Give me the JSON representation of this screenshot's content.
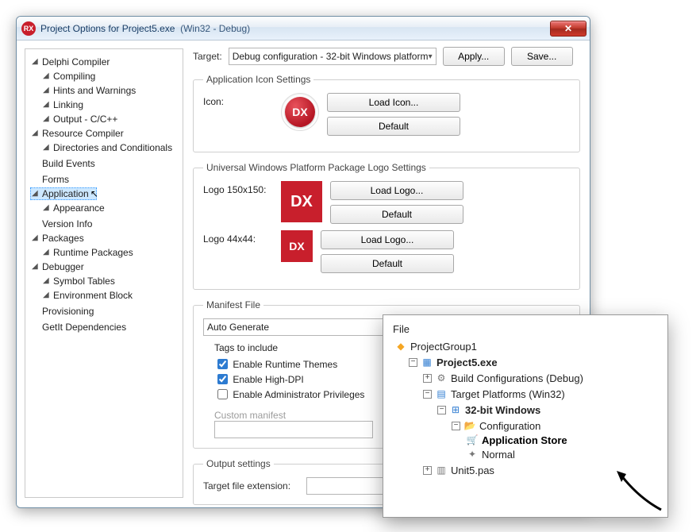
{
  "window": {
    "title_prefix": "Project Options for ",
    "project": "Project5.exe",
    "config_suffix": "(Win32 - Debug)",
    "close": "✕"
  },
  "nav": {
    "delphi_compiler": "Delphi Compiler",
    "compiling": "Compiling",
    "hints_warnings": "Hints and Warnings",
    "linking": "Linking",
    "output_c": "Output - C/C++",
    "resource_compiler": "Resource Compiler",
    "dirs_cond": "Directories and Conditionals",
    "build_events": "Build Events",
    "forms": "Forms",
    "application": "Application",
    "appearance": "Appearance",
    "version_info": "Version Info",
    "packages": "Packages",
    "runtime_packages": "Runtime Packages",
    "debugger": "Debugger",
    "symbol_tables": "Symbol Tables",
    "env_block": "Environment Block",
    "provisioning": "Provisioning",
    "getit": "GetIt Dependencies"
  },
  "top": {
    "target_label": "Target:",
    "target_value": "Debug configuration - 32-bit Windows platform",
    "apply": "Apply...",
    "save": "Save..."
  },
  "icon_group": {
    "legend": "Application Icon Settings",
    "icon_label": "Icon:",
    "dx": "DX",
    "load_icon": "Load Icon...",
    "default": "Default"
  },
  "uwp_group": {
    "legend": "Universal Windows Platform Package Logo Settings",
    "logo150_label": "Logo 150x150:",
    "logo44_label": "Logo 44x44:",
    "load_logo": "Load Logo...",
    "default": "Default"
  },
  "manifest_group": {
    "legend": "Manifest File",
    "auto_generate": "Auto Generate",
    "tags": "Tags to include",
    "enable_runtime_themes": "Enable Runtime Themes",
    "enable_high_dpi": "Enable High-DPI",
    "enable_admin": "Enable Administrator Privileges",
    "custom_manifest": "Custom manifest"
  },
  "output_group": {
    "legend": "Output settings",
    "target_ext_label": "Target file extension:"
  },
  "float": {
    "header": "File",
    "project_group": "ProjectGroup1",
    "project": "Project5.exe",
    "build_configs": "Build Configurations (Debug)",
    "target_platforms": "Target Platforms (Win32)",
    "win32": "32-bit Windows",
    "configuration": "Configuration",
    "app_store": "Application Store",
    "normal": "Normal",
    "unit": "Unit5.pas"
  }
}
